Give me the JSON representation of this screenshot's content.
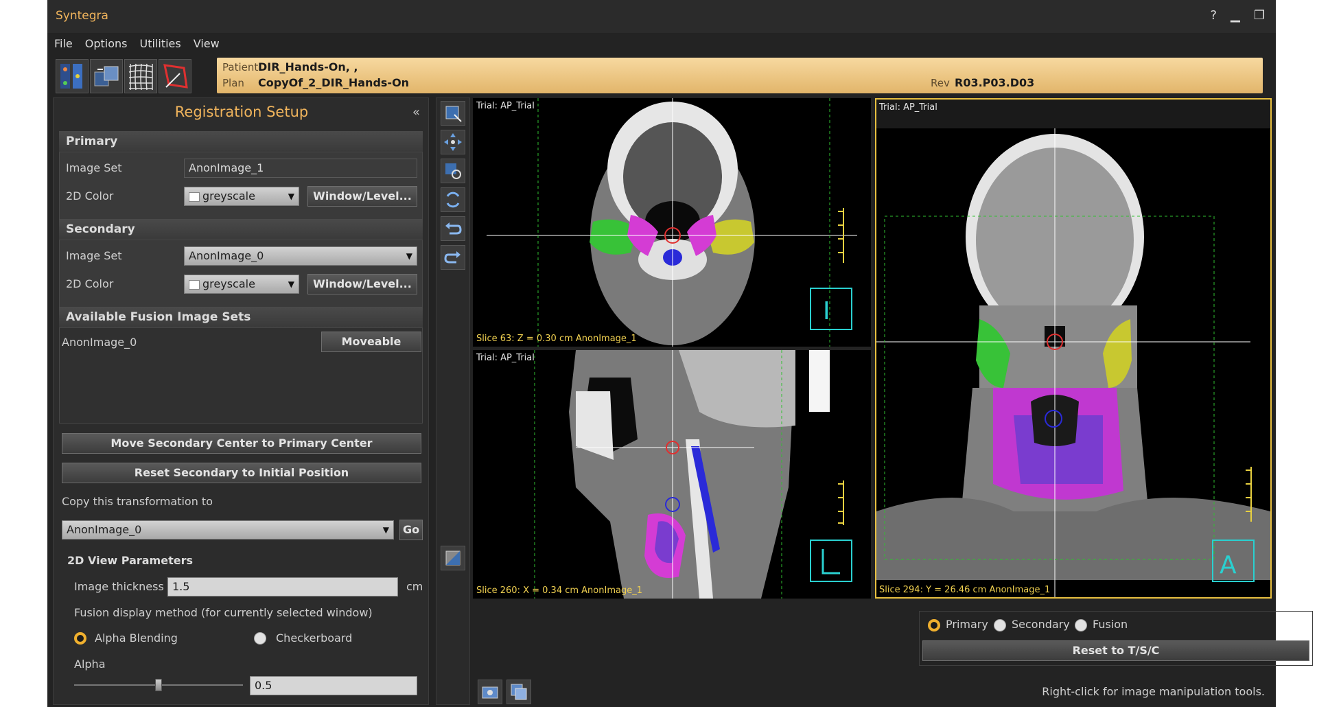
{
  "app": {
    "title": "Syntegra"
  },
  "window_controls": {
    "help": "?",
    "minimize": "▁",
    "restore": "❐"
  },
  "menu": [
    "File",
    "Options",
    "Utilities",
    "View"
  ],
  "patient_bar": {
    "patient_label": "Patient",
    "patient_value": "DIR_Hands-On, ,",
    "plan_label": "Plan",
    "plan_value": "CopyOf_2_DIR_Hands-On",
    "rev_label": "Rev",
    "rev_value": "R03.P03.D03"
  },
  "left_panel": {
    "title": "Registration Setup",
    "primary": {
      "header": "Primary",
      "image_set_label": "Image Set",
      "image_set_value": "AnonImage_1",
      "color_label": "2D Color",
      "color_value": "greyscale",
      "window_level": "Window/Level..."
    },
    "secondary": {
      "header": "Secondary",
      "image_set_label": "Image Set",
      "image_set_value": "AnonImage_0",
      "color_label": "2D Color",
      "color_value": "greyscale",
      "window_level": "Window/Level..."
    },
    "fusion": {
      "header": "Available Fusion Image Sets",
      "item": "AnonImage_0",
      "item_button": "Moveable"
    },
    "move_center": "Move Secondary Center to Primary Center",
    "reset_initial": "Reset Secondary to Initial Position",
    "copy_label": "Copy this transformation to",
    "copy_target": "AnonImage_0",
    "go": "Go",
    "view_params": {
      "header": "2D View Parameters",
      "thickness_label": "Image thickness",
      "thickness_value": "1.5",
      "thickness_unit": "cm",
      "fusion_method_label": "Fusion display method (for currently selected window)",
      "alpha_blending": "Alpha Blending",
      "checkerboard": "Checkerboard",
      "alpha_label": "Alpha",
      "alpha_value": "0.5",
      "alpha_level": 0.5
    }
  },
  "views": {
    "axial": {
      "trial": "Trial: AP_Trial",
      "slice": "Slice 63: Z = 0.30 cm AnonImage_1"
    },
    "sagittal": {
      "trial": "Trial: AP_Trial",
      "slice": "Slice 260: X = 0.34 cm AnonImage_1"
    },
    "coronal": {
      "trial": "Trial: AP_Trial",
      "slice": "Slice 294: Y = 26.46 cm AnonImage_1"
    }
  },
  "display_controls": {
    "primary": "Primary",
    "secondary": "Secondary",
    "fusion": "Fusion",
    "reset": "Reset to T/S/C"
  },
  "status_hint": "Right-click for image manipulation tools."
}
